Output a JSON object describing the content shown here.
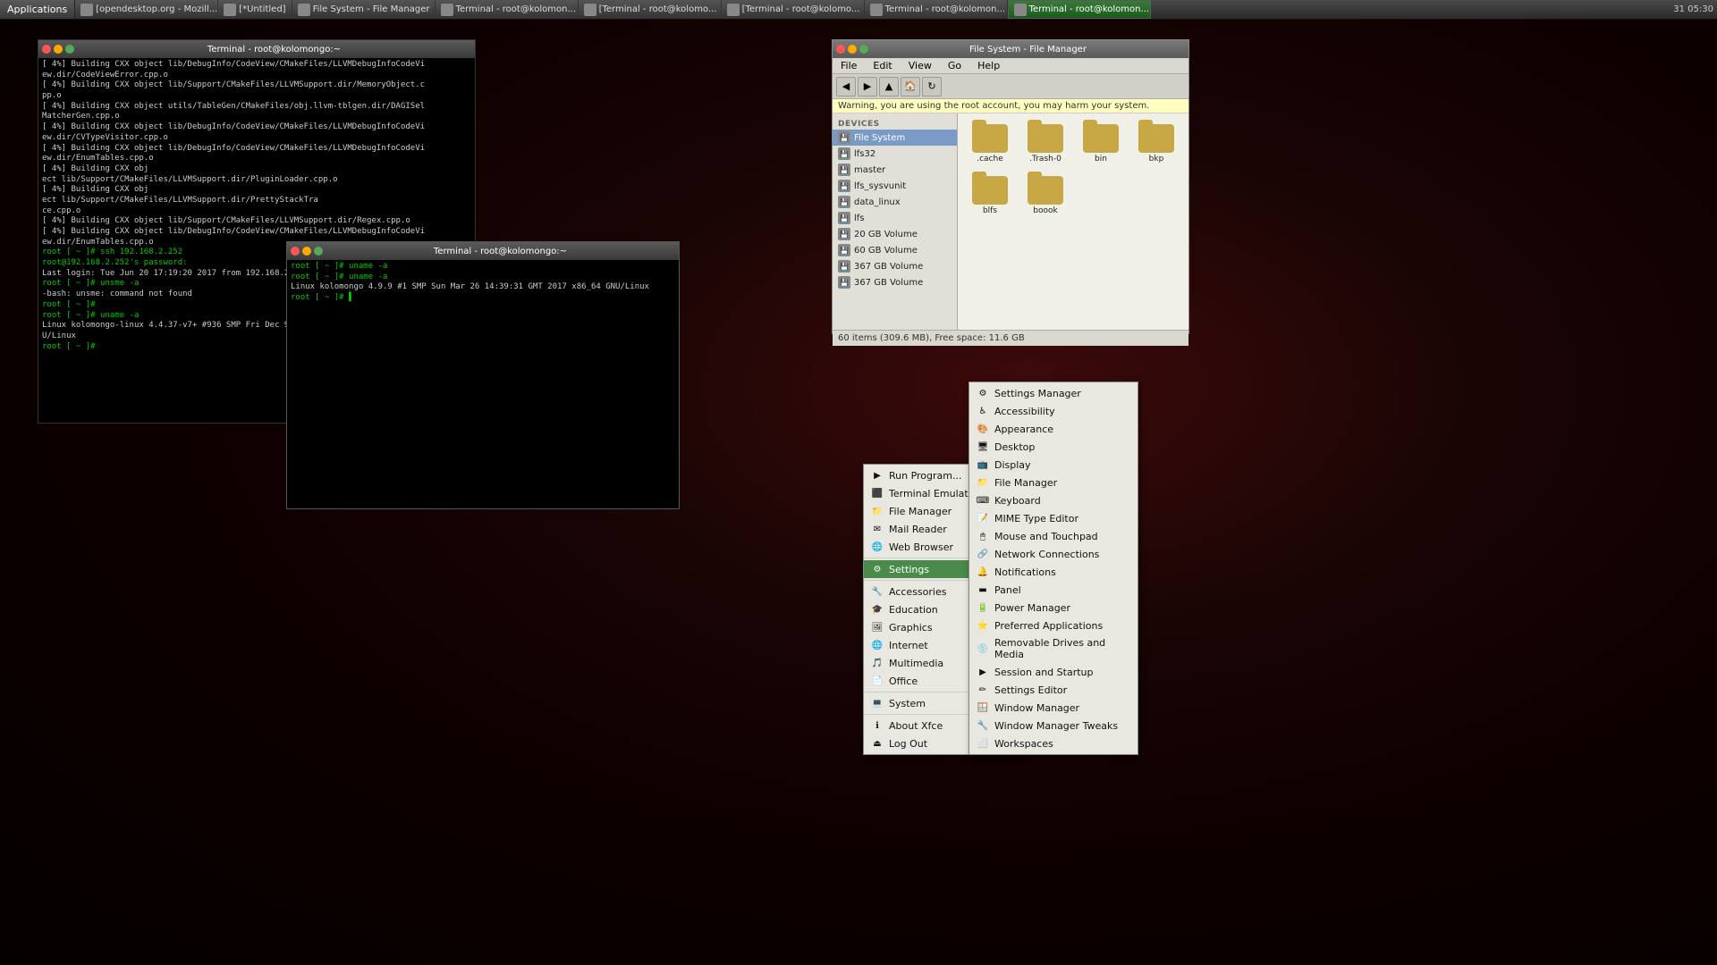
{
  "taskbar": {
    "apps_label": "Applications",
    "items": [
      {
        "label": "[opendesktop.org - Mozill...",
        "active": false
      },
      {
        "label": "[*Untitled]",
        "active": false
      },
      {
        "label": "File System - File Manager",
        "active": false
      },
      {
        "label": "Terminal - root@kolomon...",
        "active": false
      },
      {
        "label": "[Terminal - root@kolomo...",
        "active": false
      },
      {
        "label": "[Terminal - root@kolomo...",
        "active": false
      },
      {
        "label": "Terminal - root@kolomon...",
        "active": false
      },
      {
        "label": "Terminal - root@kolomon...",
        "active": true
      }
    ],
    "system_tray": "31 05:30"
  },
  "terminal1": {
    "title": "Terminal - root@kolomongo:~",
    "lines": [
      "[ 4%] Building CXX object lib/DebugInfo/CodeView/CMakeFiles/LLVMDebugInfoCodeVi",
      "ew.dir/CodeViewError.cpp.o",
      "[ 4%] Building CXX object lib/Support/CMakeFiles/LLVMSupport.dir/MemoryObject.c",
      "pp.o",
      "[ 4%] Building CXX object utils/TableGen/CMakeFiles/obj.llvm-tblgen.dir/DAGISel",
      "MatcherGen.cpp.o",
      "[ 4%] Building CXX object lib/DebugInfo/CodeView/CMakeFiles/LLVMDebugInfoCodeVi",
      "ew.dir/CVTypeVisitor.cpp.o",
      "[ 4%] Building CXX object lib/DebugInfo/CodeView/CMakeFiles/LLVMDebugInfoCodeVi",
      "ew.dir/EnumTables.cpp.o",
      "[ 4%] Building CXX obj",
      "ect lib/Support/CMakeFiles/LLVMSupport.dir/PluginLoader.cpp.o",
      "[ 4%] Building CXX obj",
      "ect lib/Support/CMakeFiles/LLVMSupport.dir/PrettyStackTra",
      "ce.cpp.o",
      "[ 4%] Building CXX object lib/Support/CMakeFiles/LLVMSupport.dir/Regex.cpp.o",
      "[ 4%] Building CXX object lib/DebugInfo/CodeView/CMakeFiles/LLVMDebugInfoCodeVi",
      "ew.dir/EnumTables.cpp.o",
      "root [ ~ ]# ssh 192.168.2.252",
      "root@192.168.2.252's password:",
      "Last login: Tue Jun 20 17:19:20 2017 from 192.168.2.253",
      "root [ ~ ]# unsme -a",
      "-bash: unsme: command not found",
      "root [ ~ ]#",
      "root [ ~ ]# uname -a",
      "Linux kolomongo-linux 4.4.37-v7+ #936 SMP Fri Dec 9 16:56:49 GMT 2016 armv71 GN",
      "U/Linux",
      "root [ ~ ]#"
    ]
  },
  "terminal2": {
    "title": "Terminal - root@kolomongo:~",
    "lines": [
      "root [ ~ ]# uname -a",
      "root [ ~ ]# uname -a",
      "Linux kolomongo 4.9.9 #1 SMP Sun Mar 26 14:39:31 GMT 2017 x86_64 GNU/Linux",
      "root [ ~ ]# ▌"
    ]
  },
  "file_manager": {
    "title": "File System - File Manager",
    "menu": [
      "File",
      "Edit",
      "View",
      "Go",
      "Help"
    ],
    "warning": "Warning, you are using the root account, you may harm your system.",
    "devices_label": "DEVICES",
    "sidebar_items": [
      {
        "label": "File System",
        "selected": true
      },
      {
        "label": "lfs32"
      },
      {
        "label": "master"
      },
      {
        "label": "lfs_sysvunit"
      },
      {
        "label": "data_linux"
      },
      {
        "label": "lfs"
      },
      {
        "label": "20 GB Volume"
      },
      {
        "label": "60 GB Volume"
      },
      {
        "label": "367 GB Volume"
      },
      {
        "label": "367 GB Volume"
      }
    ],
    "main_items": [
      {
        "label": ".cache"
      },
      {
        "label": ".Trash-0"
      },
      {
        "label": "bin"
      },
      {
        "label": "bkp"
      },
      {
        "label": "blfs"
      },
      {
        "label": "boook"
      }
    ],
    "statusbar": "60 items (309.6 MB), Free space: 11.6 GB"
  },
  "context_menu": {
    "items": [
      {
        "label": "Run Program...",
        "icon": "▶"
      },
      {
        "label": "Terminal Emulator",
        "icon": "⬛"
      },
      {
        "label": "File Manager",
        "icon": "📁"
      },
      {
        "label": "Mail Reader",
        "icon": "✉"
      },
      {
        "label": "Web Browser",
        "icon": "🌐"
      },
      {
        "separator": true
      },
      {
        "label": "Settings",
        "icon": "⚙",
        "arrow": true,
        "highlighted": true
      },
      {
        "separator": true
      },
      {
        "label": "Accessories",
        "icon": "🔧",
        "arrow": true
      },
      {
        "label": "Education",
        "icon": "🎓",
        "arrow": true
      },
      {
        "label": "Graphics",
        "icon": "🖼",
        "arrow": true
      },
      {
        "label": "Internet",
        "icon": "🌐",
        "arrow": true
      },
      {
        "label": "Multimedia",
        "icon": "🎵",
        "arrow": true
      },
      {
        "label": "Office",
        "icon": "📄",
        "arrow": true
      },
      {
        "separator": true
      },
      {
        "label": "System",
        "icon": "💻"
      },
      {
        "separator": true
      },
      {
        "label": "About Xfce",
        "icon": "ℹ"
      },
      {
        "label": "Log Out",
        "icon": "⏏"
      }
    ]
  },
  "settings_submenu": {
    "items": [
      {
        "label": "Settings Manager",
        "icon": "⚙"
      },
      {
        "label": "Accessibility",
        "icon": "♿"
      },
      {
        "label": "Appearance",
        "icon": "🎨"
      },
      {
        "label": "Desktop",
        "icon": "🖥"
      },
      {
        "label": "Display",
        "icon": "📺"
      },
      {
        "label": "File Manager",
        "icon": "📁"
      },
      {
        "label": "Keyboard",
        "icon": "⌨"
      },
      {
        "label": "MIME Type Editor",
        "icon": "📝"
      },
      {
        "label": "Mouse and Touchpad",
        "icon": "🖱"
      },
      {
        "label": "Network Connections",
        "icon": "🔗"
      },
      {
        "label": "Notifications",
        "icon": "🔔"
      },
      {
        "label": "Panel",
        "icon": "▬"
      },
      {
        "label": "Power Manager",
        "icon": "🔋"
      },
      {
        "label": "Preferred Applications",
        "icon": "⭐"
      },
      {
        "label": "Removable Drives and Media",
        "icon": "💿"
      },
      {
        "label": "Session and Startup",
        "icon": "▶"
      },
      {
        "label": "Settings Editor",
        "icon": "✏"
      },
      {
        "label": "Window Manager",
        "icon": "🪟"
      },
      {
        "label": "Window Manager Tweaks",
        "icon": "🔧"
      },
      {
        "label": "Workspaces",
        "icon": "⬜"
      }
    ]
  }
}
